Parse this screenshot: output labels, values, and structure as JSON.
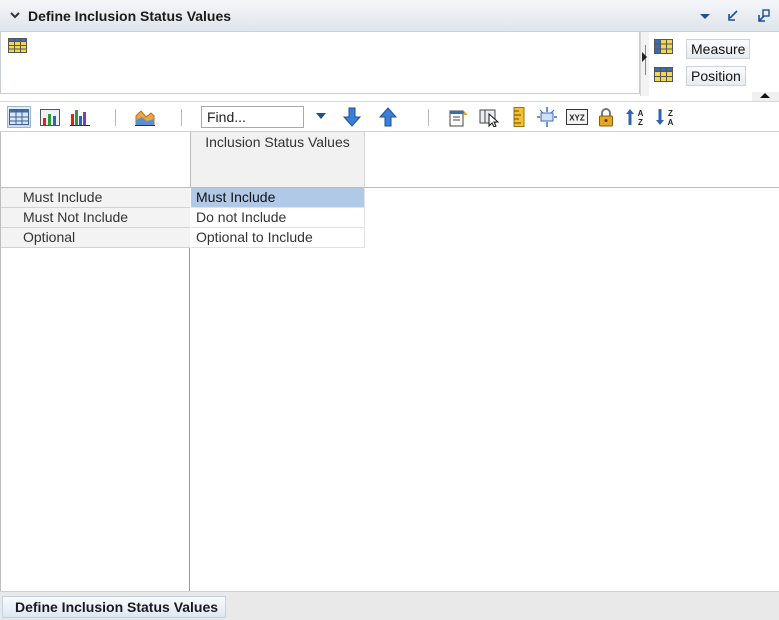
{
  "header": {
    "title": "Define Inclusion Status Values"
  },
  "tiles": [
    {
      "label": "Measure"
    },
    {
      "label": "Position"
    }
  ],
  "toolbar": {
    "find_value": "Find...",
    "buttons": [
      "grid-view-icon",
      "chart-grid-icon",
      "bar-chart-icon",
      "area-chart-icon",
      "find-next-icon",
      "find-previous-icon",
      "format-icon",
      "cursor-select-icon",
      "ruler-icon",
      "spread-icon",
      "xyz-icon",
      "lock-icon",
      "sort-ascending-icon",
      "sort-descending-icon"
    ]
  },
  "grid": {
    "column_header": "Inclusion Status Values",
    "rows": [
      {
        "label": "Must Include",
        "value": "Must Include"
      },
      {
        "label": "Must Not Include",
        "value": "Do not Include"
      },
      {
        "label": "Optional",
        "value": "Optional to Include"
      }
    ]
  },
  "bottom_tab": {
    "label": "Define Inclusion Status Values"
  },
  "colors": {
    "accent": "#1d4f91",
    "selection": "#b0c9e6"
  }
}
